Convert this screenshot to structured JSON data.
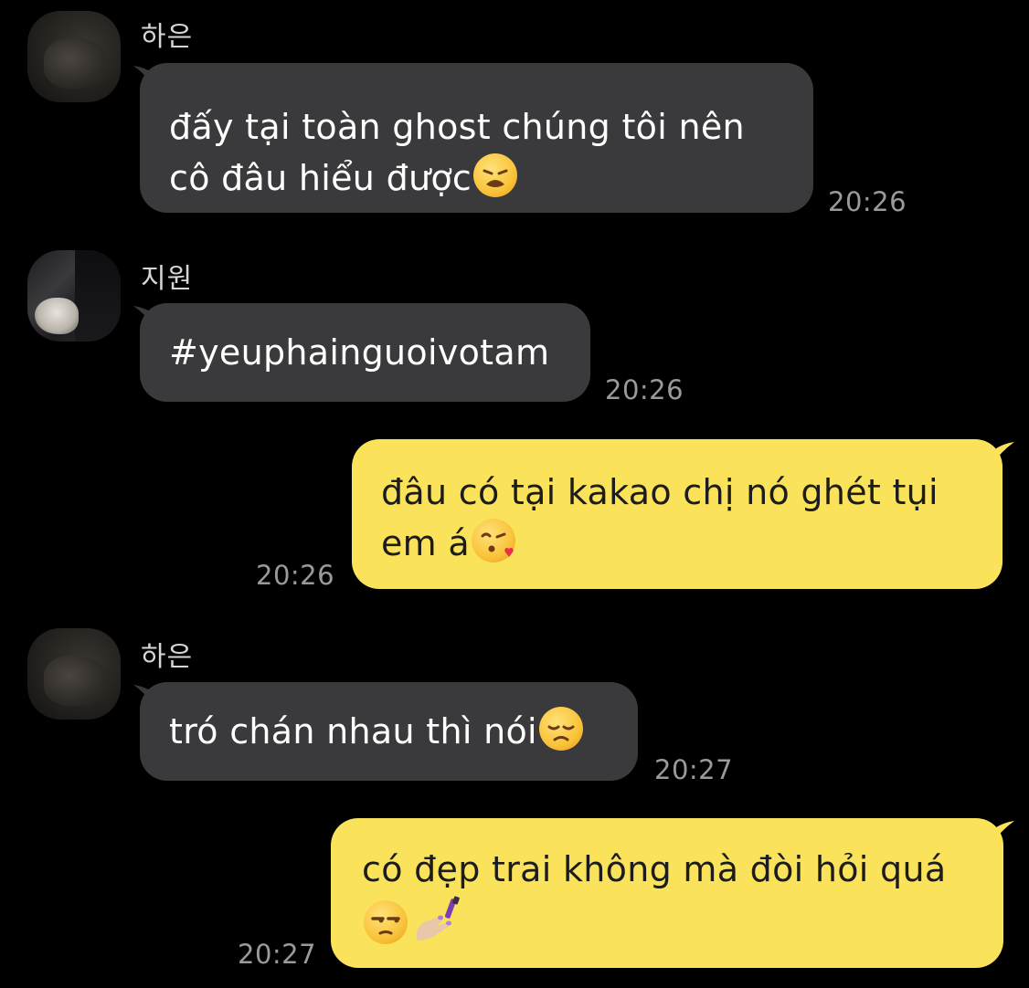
{
  "messages": [
    {
      "sender": "하은",
      "text": "đấy tại toàn ghost chúng tôi nên cô đâu hiểu được",
      "line1": "đấy tại toàn ghost chúng tôi nên",
      "line2": "cô đâu hiểu được",
      "emoji": "weary-face-icon",
      "time": "20:26",
      "direction": "incoming"
    },
    {
      "sender": "지원",
      "text": "#yeuphainguoivotam",
      "emoji": "",
      "time": "20:26",
      "direction": "incoming"
    },
    {
      "sender": "",
      "text": "đâu có tại kakao chị nó ghét tụi em á",
      "line1": "đâu có tại kakao chị nó ghét tụi",
      "line2": "em á",
      "emoji": "face-blowing-kiss-icon",
      "time": "20:26",
      "direction": "outgoing"
    },
    {
      "sender": "하은",
      "text": "tró chán nhau thì nói",
      "emoji": "pensive-face-icon",
      "time": "20:27",
      "direction": "incoming"
    },
    {
      "sender": "",
      "text": "có đẹp trai không mà đòi hỏi quá",
      "line1": "có đẹp trai không mà đòi hỏi quá",
      "line2": "",
      "emoji": "unamused-face-icon",
      "emoji2": "nail-polish-icon",
      "time": "20:27",
      "direction": "outgoing"
    }
  ],
  "colors": {
    "background": "#000000",
    "incoming_bubble": "#3a3a3c",
    "outgoing_bubble": "#fae35a",
    "timestamp": "#9a9a9a",
    "sender_name": "#d6d6d6"
  }
}
